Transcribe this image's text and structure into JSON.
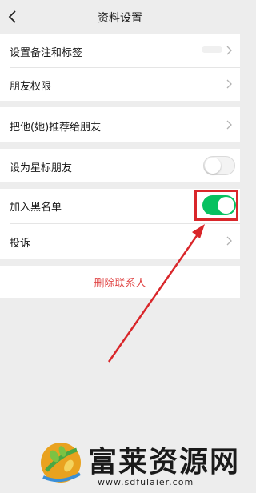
{
  "header": {
    "title": "资料设置",
    "back_icon": "chevron-left-icon"
  },
  "rows": {
    "remark": {
      "label": "设置备注和标签"
    },
    "permissions": {
      "label": "朋友权限"
    },
    "recommend": {
      "label": "把他(她)推荐给朋友"
    },
    "star": {
      "label": "设为星标朋友",
      "toggle_on": false
    },
    "blacklist": {
      "label": "加入黑名单",
      "toggle_on": true
    },
    "report": {
      "label": "投诉"
    }
  },
  "delete_button": {
    "label": "删除联系人"
  },
  "colors": {
    "toggle_on": "#07c160",
    "annotation": "#d9262a",
    "delete": "#e04545"
  },
  "watermark": {
    "title": "富莱资源网",
    "url": "www.sdfulaier.com"
  }
}
